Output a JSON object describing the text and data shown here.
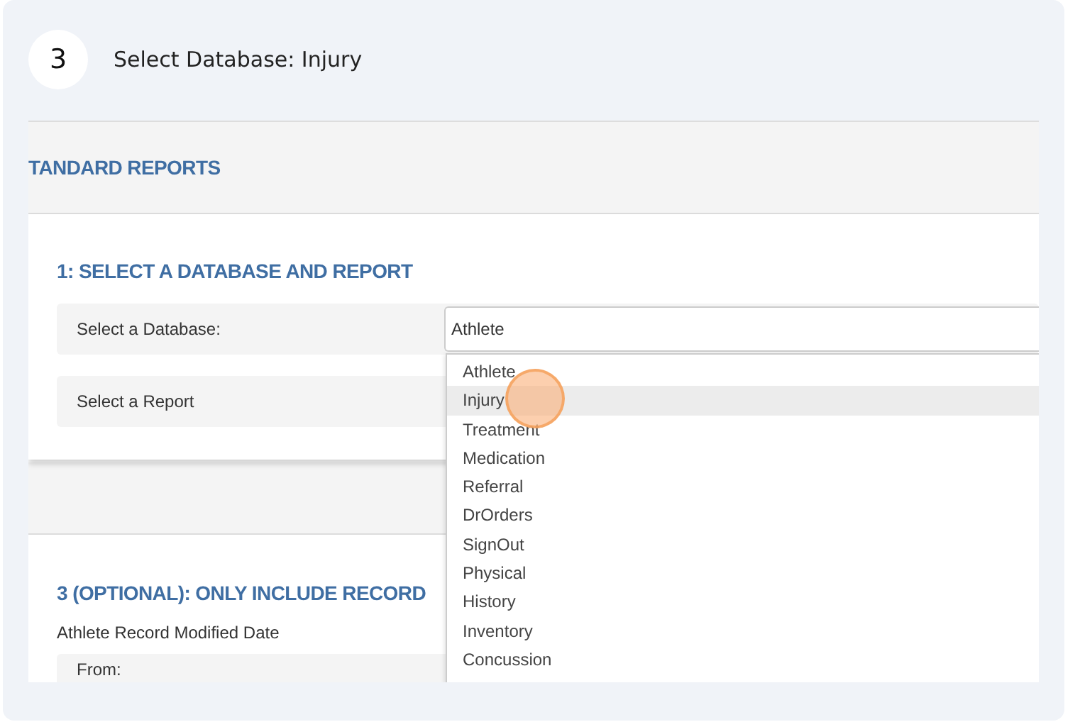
{
  "step": {
    "number": "3",
    "title": "Select Database: Injury"
  },
  "page_title": "TANDARD REPORTS",
  "section_1": {
    "heading": "1: SELECT A DATABASE AND REPORT",
    "rows": [
      {
        "label": "Select a Database:",
        "value": "Athlete"
      },
      {
        "label": "Select a Report"
      }
    ]
  },
  "section_3": {
    "heading": "3 (OPTIONAL): ONLY INCLUDE RECORD",
    "subheading": "Athlete Record Modified Date",
    "rows": [
      {
        "label": "From:"
      }
    ]
  },
  "dropdown": {
    "options": [
      {
        "label": "Athlete",
        "selected": false
      },
      {
        "label": "Injury",
        "selected": true
      },
      {
        "label": "Treatment",
        "selected": false
      },
      {
        "label": "Medication",
        "selected": false
      },
      {
        "label": "Referral",
        "selected": false
      },
      {
        "label": "DrOrders",
        "selected": false
      },
      {
        "label": "SignOut",
        "selected": false
      },
      {
        "label": "Physical",
        "selected": false
      },
      {
        "label": "History",
        "selected": false
      },
      {
        "label": "Inventory",
        "selected": false
      },
      {
        "label": "Concussion",
        "selected": false
      }
    ]
  }
}
